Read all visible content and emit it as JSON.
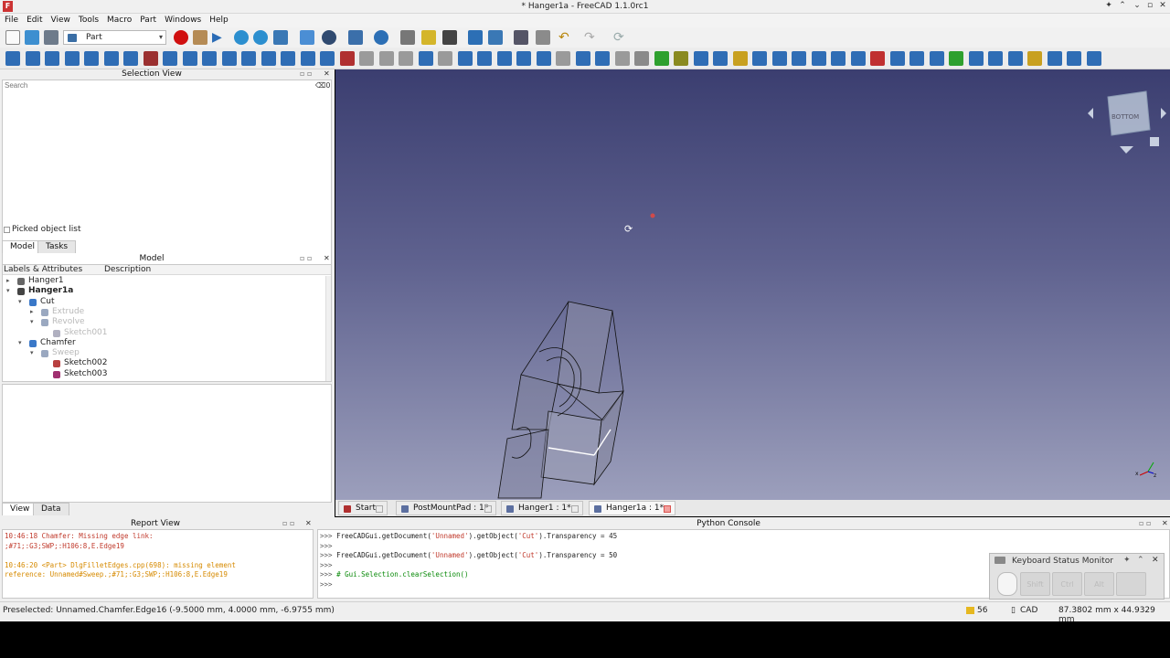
{
  "window": {
    "title": "* Hanger1a - FreeCAD 1.1.0rc1"
  },
  "menu": [
    "File",
    "Edit",
    "View",
    "Tools",
    "Macro",
    "Part",
    "Windows",
    "Help"
  ],
  "toolbar": {
    "workbench": "Part"
  },
  "selection_view": {
    "header": "Selection View",
    "search_placeholder": "Search",
    "count": "0",
    "picked_label": "Picked object list"
  },
  "model_panel": {
    "tabs": [
      "Model",
      "Tasks"
    ],
    "header": "Model",
    "columns": [
      "Labels & Attributes",
      "Description"
    ],
    "tree": [
      {
        "label": "Hanger1",
        "expander": "▸",
        "bold": false,
        "disabled": false
      },
      {
        "label": "Hanger1a",
        "expander": "▾",
        "bold": true,
        "disabled": false
      },
      {
        "label": "Cut",
        "expander": "▾",
        "bold": false,
        "disabled": false
      },
      {
        "label": "Extrude",
        "expander": "▸",
        "bold": false,
        "disabled": true
      },
      {
        "label": "Revolve",
        "expander": "▾",
        "bold": false,
        "disabled": true
      },
      {
        "label": "Sketch001",
        "expander": "",
        "bold": false,
        "disabled": true
      },
      {
        "label": "Chamfer",
        "expander": "▾",
        "bold": false,
        "disabled": false
      },
      {
        "label": "Sweep",
        "expander": "▾",
        "bold": false,
        "disabled": true
      },
      {
        "label": "Sketch002",
        "expander": "",
        "bold": false,
        "disabled": false
      },
      {
        "label": "Sketch003",
        "expander": "",
        "bold": false,
        "disabled": false
      }
    ],
    "property_tabs": [
      "View",
      "Data"
    ]
  },
  "doc_tabs": [
    "Start",
    "PostMountPad : 1*",
    "Hanger1 : 1*",
    "Hanger1a : 1*"
  ],
  "report_view": {
    "header": "Report View",
    "lines": [
      "10:46:18  Chamfer: Missing edge link:",
      ";#71;:G3;SWP;:H106:8,E.Edge19",
      "",
      "10:46:20  <Part> DlgFilletEdges.cpp(698): missing element",
      "reference: Unnamed#Sweep.;#71;:G3;SWP;:H106:8,E.Edge19"
    ]
  },
  "python_console": {
    "header": "Python Console",
    "lines": [
      {
        "prompt": ">>>",
        "pre": "FreeCADGui.getDocument(",
        "s1": "'Unnamed'",
        "mid": ").getObject(",
        "s2": "'Cut'",
        "post": ").Transparency = 45"
      },
      {
        "prompt": ">>>",
        "pre": "",
        "s1": "",
        "mid": "",
        "s2": "",
        "post": ""
      },
      {
        "prompt": ">>>",
        "pre": "FreeCADGui.getDocument(",
        "s1": "'Unnamed'",
        "mid": ").getObject(",
        "s2": "'Cut'",
        "post": ").Transparency = 50"
      },
      {
        "prompt": ">>>",
        "pre": "",
        "s1": "",
        "mid": "",
        "s2": "",
        "post": ""
      },
      {
        "prompt": ">>>",
        "comment": "# Gui.Selection.clearSelection()"
      },
      {
        "prompt": ">>>",
        "pre": "",
        "s1": "",
        "mid": "",
        "s2": "",
        "post": ""
      }
    ]
  },
  "keyboard_monitor": {
    "title": "Keyboard Status Monitor",
    "keys": [
      "Shift",
      "Ctrl",
      "Alt",
      ""
    ]
  },
  "statusbar": {
    "message": "Preselected: Unnamed.Chamfer.Edge16 (-9.5000 mm, 4.0000 mm, -6.9755 mm)",
    "count": "56",
    "nav": "CAD",
    "dimensions": "87.3802 mm x 44.9329 mm"
  },
  "navcube": {
    "face": "BOTTOM"
  },
  "axis": {
    "x": "x",
    "z": "z"
  }
}
